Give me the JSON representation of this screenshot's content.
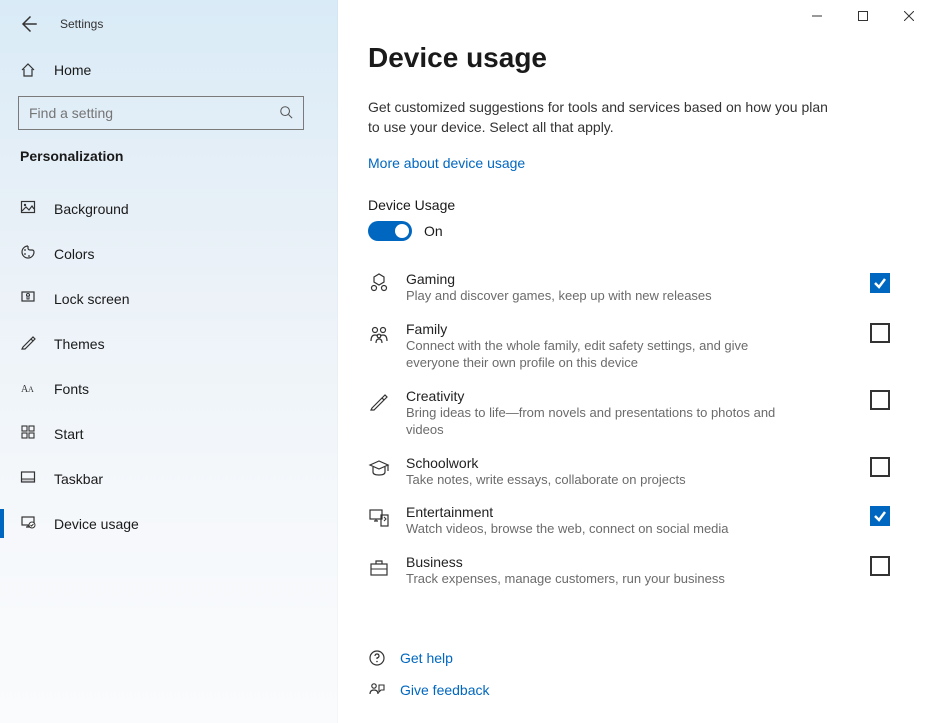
{
  "titlebar": {
    "app_name": "Settings"
  },
  "sidebar": {
    "home": "Home",
    "search_placeholder": "Find a setting",
    "section": "Personalization",
    "items": [
      {
        "id": "background",
        "label": "Background"
      },
      {
        "id": "colors",
        "label": "Colors"
      },
      {
        "id": "lock-screen",
        "label": "Lock screen"
      },
      {
        "id": "themes",
        "label": "Themes"
      },
      {
        "id": "fonts",
        "label": "Fonts"
      },
      {
        "id": "start",
        "label": "Start"
      },
      {
        "id": "taskbar",
        "label": "Taskbar"
      },
      {
        "id": "device-usage",
        "label": "Device usage"
      }
    ]
  },
  "main": {
    "title": "Device usage",
    "description": "Get customized suggestions for tools and services based on how you plan to use your device. Select all that apply.",
    "more_link": "More about device usage",
    "sub_header": "Device Usage",
    "toggle_state": "On",
    "usage": [
      {
        "id": "gaming",
        "title": "Gaming",
        "desc": "Play and discover games, keep up with new releases",
        "checked": true
      },
      {
        "id": "family",
        "title": "Family",
        "desc": "Connect with the whole family, edit safety settings, and give everyone their own profile on this device",
        "checked": false
      },
      {
        "id": "creativity",
        "title": "Creativity",
        "desc": "Bring ideas to life—from novels and presentations to photos and videos",
        "checked": false
      },
      {
        "id": "schoolwork",
        "title": "Schoolwork",
        "desc": "Take notes, write essays, collaborate on projects",
        "checked": false
      },
      {
        "id": "entertainment",
        "title": "Entertainment",
        "desc": "Watch videos, browse the web, connect on social media",
        "checked": true
      },
      {
        "id": "business",
        "title": "Business",
        "desc": "Track expenses, manage customers, run your business",
        "checked": false
      }
    ],
    "footer": {
      "help": "Get help",
      "feedback": "Give feedback"
    }
  }
}
